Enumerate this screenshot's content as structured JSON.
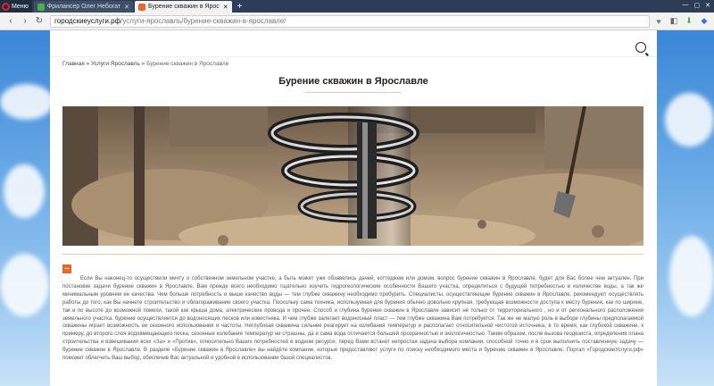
{
  "browser": {
    "menu_label": "Меню",
    "tabs": [
      {
        "label": "Фрилансер Олег Небогат",
        "active": false
      },
      {
        "label": "Бурение скважин в Ярос",
        "active": true
      }
    ],
    "new_tab": "+",
    "url_domain": "городскиеуслуги.рф",
    "url_path": "/услуги-ярославль/бурение-скважин-в-ярославле/"
  },
  "breadcrumb": {
    "home": "Главная",
    "sep1": " » ",
    "section": "Услуги Ярославль",
    "sep2": " » ",
    "current": "Бурение скважин в Ярославле"
  },
  "page": {
    "title": "Бурение скважин в Ярославле",
    "toggle_symbol": "–",
    "body": "Если Вы наконец-то осуществили мечту о собственном земельном участке, а быть может уже обзавелись дачей, коттеджем или домом, вопрос бурение скважин в Ярославле, будет для Вас более чем актуален. При постановке задачи бурение скважин в Ярославле, Вам прежде всего необходимо тщательно изучить гидрогеологические особенности Вашего участка, определиться с будущей потребностью в количестве воды, а так же минимальным уровнем ее качества. Чем больше потребность и выше качество воды — тем глубже скважину необходимо пробурить. Специалисты, осуществляющие бурение скважин в Ярославле, рекомендуют осуществлять работы до того, как Вы начнете строительство и облагораживание своего участка. Поскольку сама техника, используемая для бурения обычно довольно крупная, требующая возможности доступа к месту бурения, как по ширине, так и по высоте до возможной помехи, такой как крыша дома, электрические провода и прочее. Способ и глубина бурение скважин в Ярославле зависит не только от территориального , но и от регионального расположения земельного участка. бурение осуществляется до водоносящих песков или известняка. И чем глубже залегает водоносный пласт — тем глубже скважина Вам потребуется. Так же не малую роль в выборе глубины предполагаемой скважины играет возможность ее сезонного использования и частоты. Неглубокая скважина сильнее реагирует на колебания температур и располагает относительной чистотой источника, в то время, как глубокой скважине, к примеру, до второго слоя водовмещающего песка, сезонные колебания температур не страшны, да и сама вода отличается большей прозрачностью и экологичностью. Таким образом, после вызова геодезиста, определения плана строительства и взвешивания всех «За» и «Против», относительно Ваших потребностей в водном ресурсе, перед Вами встанет непростая задача выбора компании, способной точно и в срок выполнить поставленную задачу — бурение скважин в Ярославле. В разделе «Бурение скважин в Ярославле» вы найдёте компании, которые предоставляют услуги по поиску необходимого места и бурению скважин в Ярославле. Портал «ГородскиеУслуги.рф» поможет облегчить Ваш выбор, обеспечив Вас актуальной и удобной в использовании базой специалистов."
  },
  "colors": {
    "accent": "#e8682a",
    "tab_favicon_1": "#4caf50",
    "tab_favicon_2": "#e8682a"
  }
}
